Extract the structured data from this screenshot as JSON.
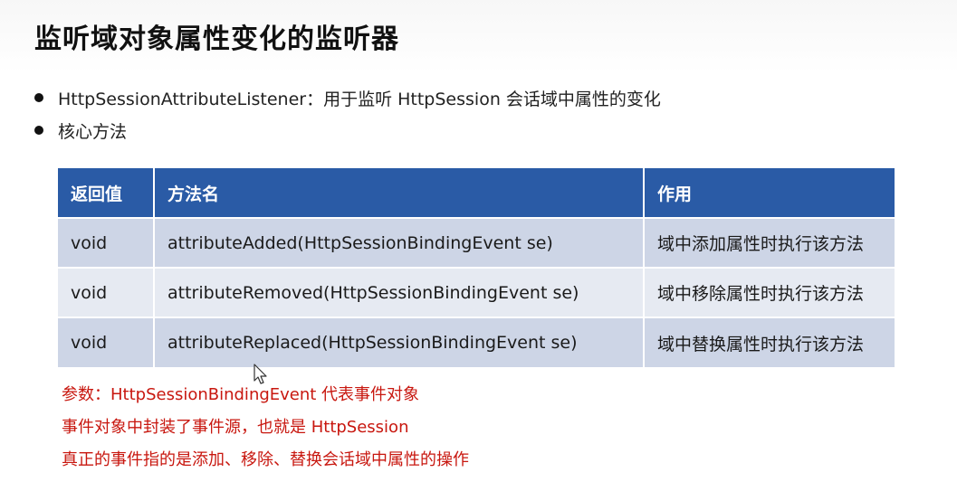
{
  "title": "监听域对象属性变化的监听器",
  "bullets": [
    "HttpSessionAttributeListener：用于监听 HttpSession 会话域中属性的变化",
    "核心方法"
  ],
  "table": {
    "headers": [
      "返回值",
      "方法名",
      "作用"
    ],
    "rows": [
      [
        "void",
        "attributeAdded(HttpSessionBindingEvent se)",
        "域中添加属性时执行该方法"
      ],
      [
        "void",
        "attributeRemoved(HttpSessionBindingEvent se)",
        "域中移除属性时执行该方法"
      ],
      [
        "void",
        "attributeReplaced(HttpSessionBindingEvent se)",
        "域中替换属性时执行该方法"
      ]
    ]
  },
  "notes": [
    "参数：HttpSessionBindingEvent 代表事件对象",
    "事件对象中封装了事件源，也就是 HttpSession",
    "真正的事件指的是添加、移除、替换会话域中属性的操作"
  ],
  "colors": {
    "header_bg": "#2a5ba6",
    "row_dark": "#cdd5e6",
    "row_light": "#e6eaf2",
    "note_text": "#c8170f"
  }
}
